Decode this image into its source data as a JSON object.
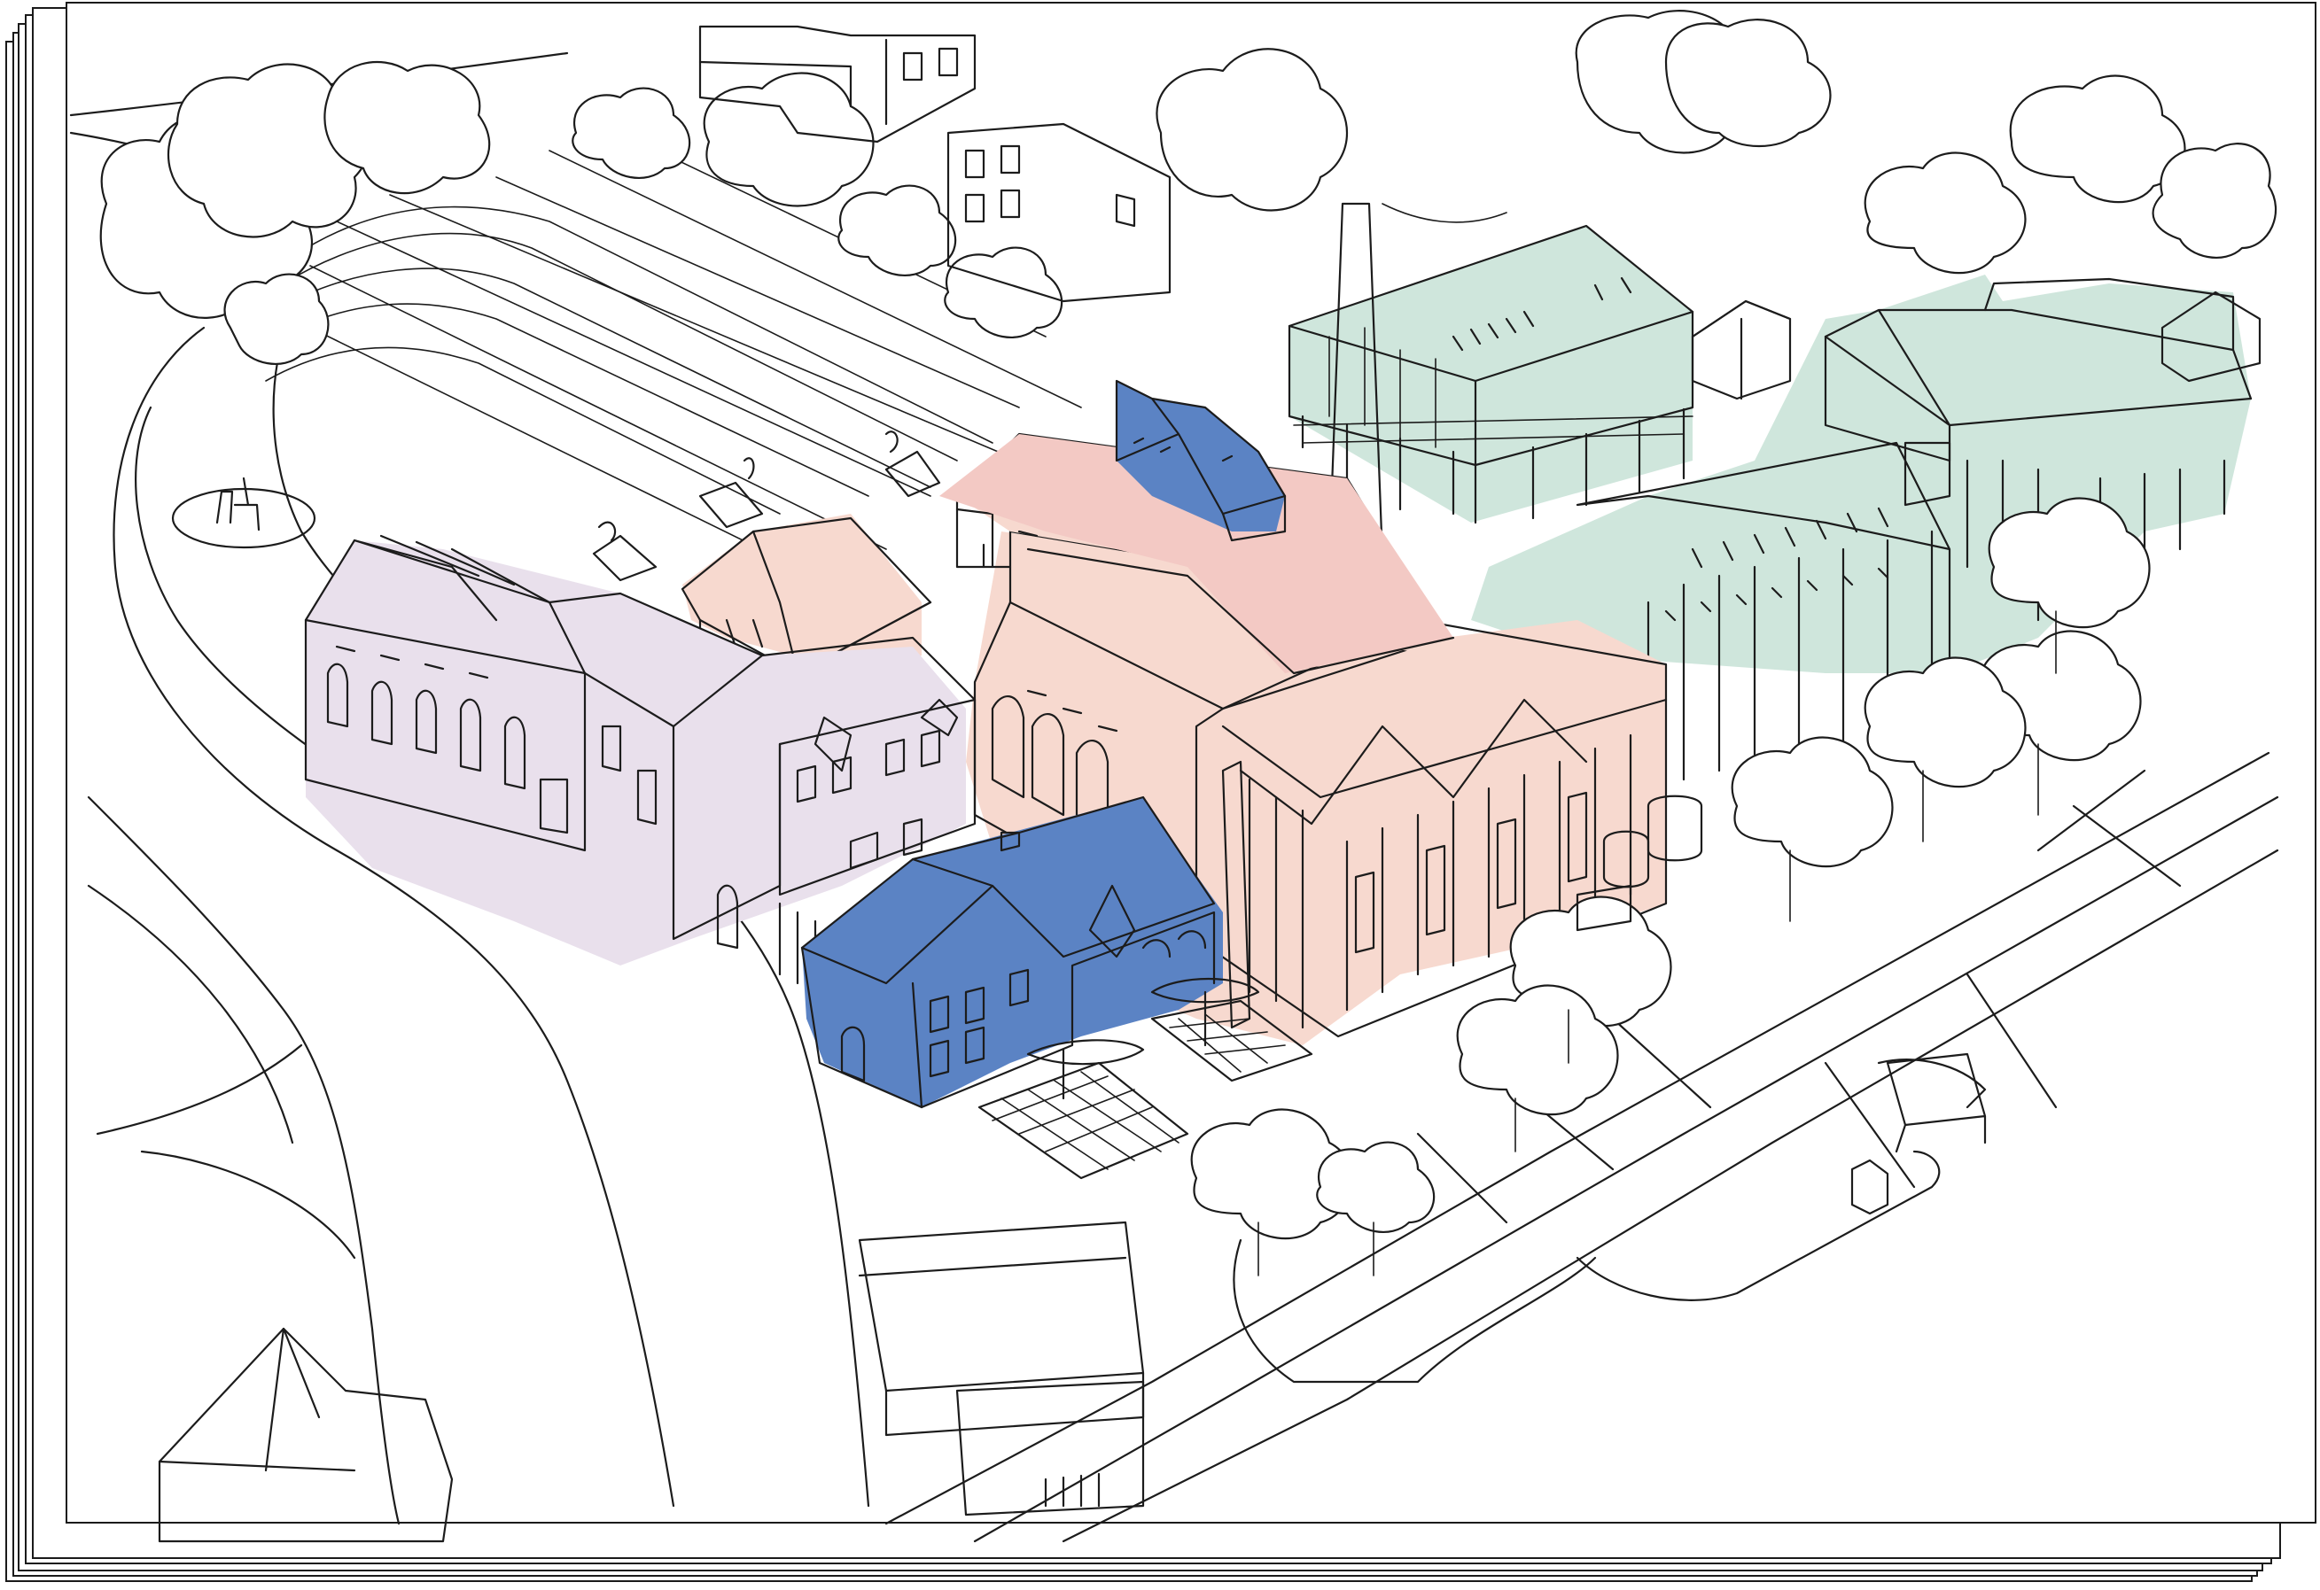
{
  "image_kind": "hand-drawn axonometric site sketch on a stack of paper sheets",
  "sheet_count": 6,
  "palette": {
    "ink": "#1c1c1c",
    "paper": "#ffffff",
    "heritage_blue": "#5b83c4",
    "salmon": "#f7d9cf",
    "rose": "#f3c9c4",
    "lavender": "#e9e0ec",
    "mint": "#cfe6dc"
  },
  "building_groups": [
    {
      "name": "blue-cottages",
      "color_key": "heritage_blue"
    },
    {
      "name": "salmon-industrial-halls",
      "color_key": "salmon"
    },
    {
      "name": "rose-roof-hall",
      "color_key": "rose"
    },
    {
      "name": "lavender-terrace",
      "color_key": "lavender"
    },
    {
      "name": "mint-warehouses",
      "color_key": "mint"
    }
  ],
  "icons": [
    "tree-icon",
    "chimney-icon",
    "playground-icon",
    "bus-shelter-icon"
  ]
}
